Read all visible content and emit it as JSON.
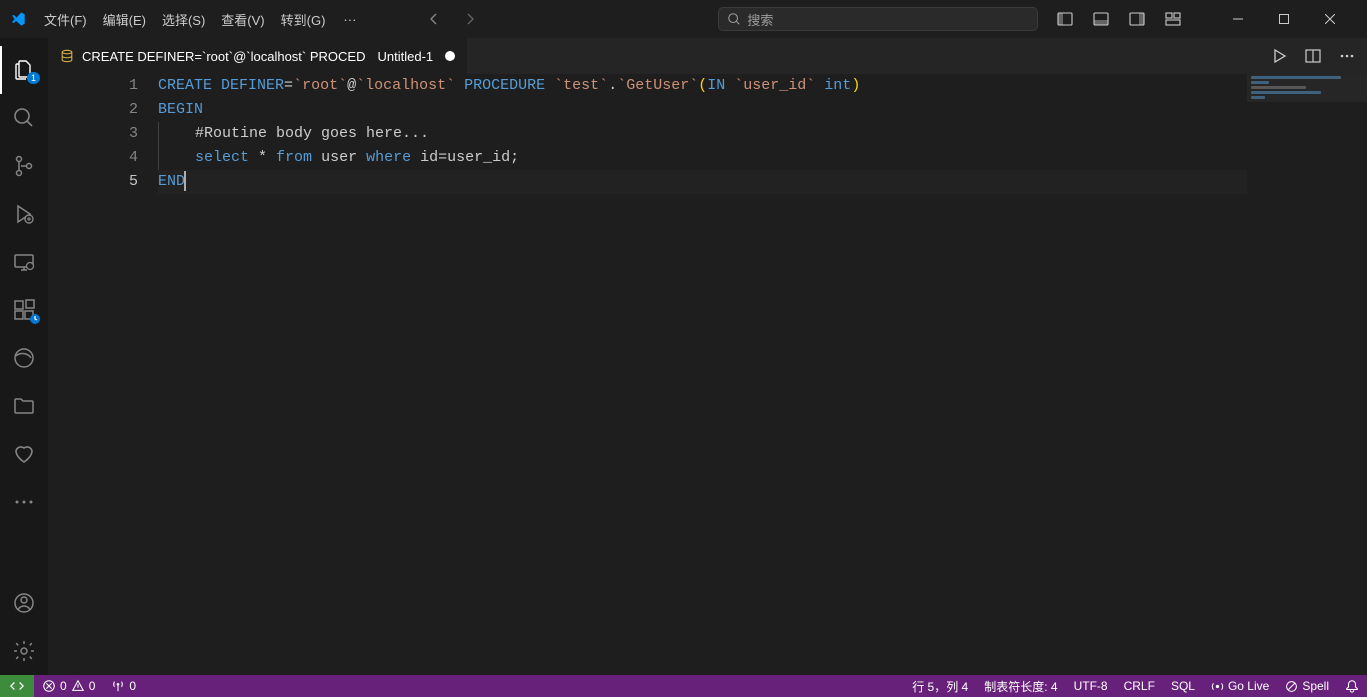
{
  "menu": {
    "file": "文件(F)",
    "edit": "编辑(E)",
    "select": "选择(S)",
    "view": "查看(V)",
    "goto": "转到(G)",
    "more": "···"
  },
  "search": {
    "placeholder": "搜索"
  },
  "tab": {
    "title": "CREATE DEFINER=`root`@`localhost` PROCED",
    "untitled": "Untitled-1"
  },
  "activitybar": {
    "explorer_badge": "1"
  },
  "code": {
    "lines": [
      "1",
      "2",
      "3",
      "4",
      "5"
    ],
    "l1": {
      "create": "CREATE",
      "definer": "DEFINER",
      "eq": "=",
      "root": "`root`",
      "at": "@",
      "localhost": "`localhost`",
      "procedure": "PROCEDURE",
      "testdb": "`test`",
      "dot": ".",
      "getuser": "`GetUser`",
      "open": "(",
      "in": "IN",
      "userid": "`user_id`",
      "inttype": "int",
      "close": ")"
    },
    "l2": {
      "begin": "BEGIN"
    },
    "l3": {
      "comment": "#Routine body goes here..."
    },
    "l4": {
      "select": "select",
      "star": " * ",
      "from": "from",
      "user": " user ",
      "where": "where",
      "rest": " id=user_id;"
    },
    "l5": {
      "end": "END"
    }
  },
  "status": {
    "errors": "0",
    "warnings": "0",
    "ports": "0",
    "cursor": "行 5，列 4",
    "tabsize": "制表符长度: 4",
    "encoding": "UTF-8",
    "eol": "CRLF",
    "lang": "SQL",
    "golive": "Go Live",
    "spell": "Spell"
  }
}
